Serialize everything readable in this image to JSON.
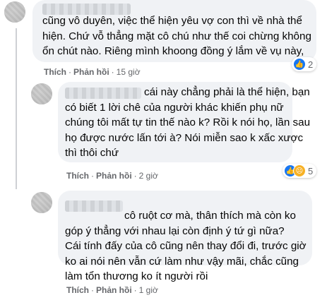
{
  "comments": [
    {
      "lines": [
        "cũng vô duyên, việc thể hiện yêu vợ con thì về nhà thể",
        "hiện. Chứ vỗ thẳng mặt cô chú như thế coi chừng không",
        "ổn chút nào. Riêng mình khoong đồng ý lắm về vụ này,"
      ],
      "actions": {
        "like": "Thích",
        "reply": "Phản hồi",
        "time": "15 giờ"
      },
      "reaction_count": "2",
      "reaction_icons": [
        "like-icon"
      ]
    },
    {
      "lines": [
        "cái này chẳng phải là thể hiện, bạn",
        "có biết 1 lời chê của người khác khiến phụ nữ",
        "chúng tôi mất tự tin thế nào k? Rồi k nói họ, lần sau",
        "họ được nước lấn tới à? Nói miễn sao k xấc xược",
        "thì thôi chứ"
      ],
      "actions": {
        "like": "Thích",
        "reply": "Phản hồi",
        "time": "2 giờ"
      },
      "reaction_count": "5",
      "reaction_icons": [
        "like-icon",
        "sad-icon"
      ]
    },
    {
      "lines": [
        "cô ruột cơ mà, thân thích mà còn ko",
        "góp ý thẳng với nhau lại còn định ý tứ gì nữa?",
        "Cái tính đấy của cô cũng nên thay đổi đi, trước giờ",
        "ko ai nói nên vẫn cứ làm như vậy mãi, chắc cũng",
        "làm tổn thương ko ít người rồi"
      ],
      "actions": {
        "like": "Thích",
        "reply": "Phản hồi",
        "time": "1 giờ"
      }
    }
  ],
  "colors": {
    "bubble": "#f0f2f5",
    "meta": "#65676b",
    "like": "#1877f2",
    "sad": "#f7b125"
  }
}
